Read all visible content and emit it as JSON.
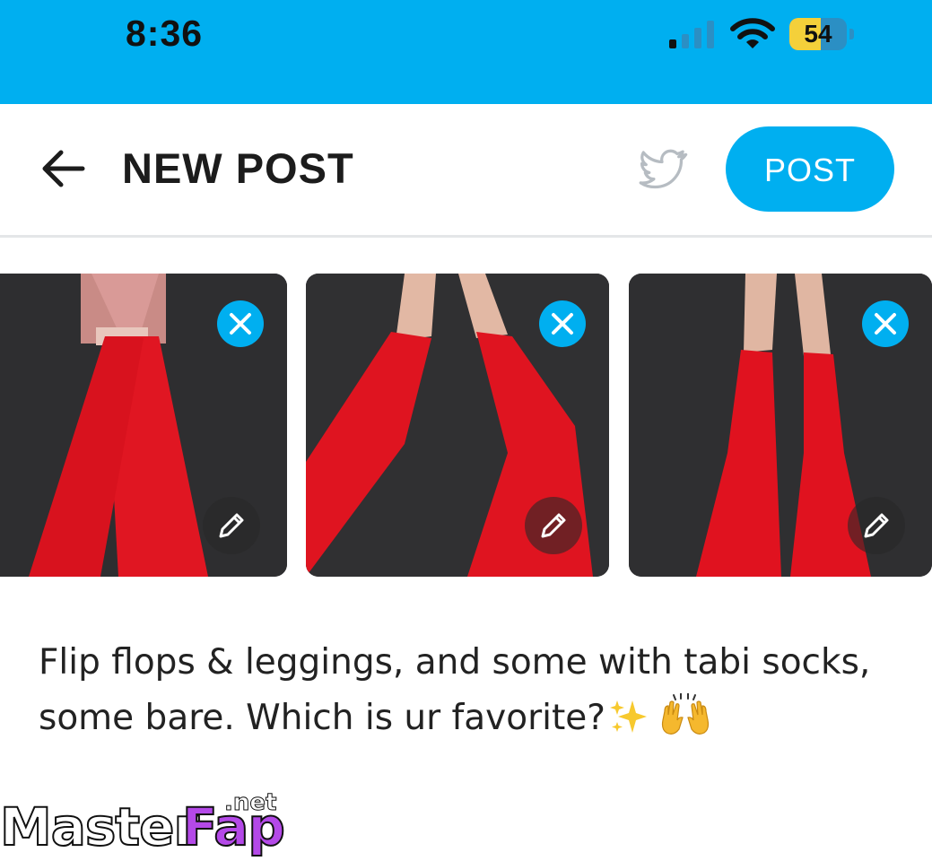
{
  "status_bar": {
    "time": "8:36",
    "battery_percent": "54",
    "battery_level": 0.54,
    "signal_bars_active": 1,
    "signal_bars_total": 4,
    "icons": [
      "signal-icon",
      "wifi-icon",
      "battery-icon"
    ]
  },
  "header": {
    "back_icon": "arrow-left-icon",
    "title": "NEW POST",
    "twitter_icon": "twitter-bird-icon",
    "post_label": "POST"
  },
  "media": [
    {
      "remove_icon": "close-icon",
      "edit_icon": "pencil-icon"
    },
    {
      "remove_icon": "close-icon",
      "edit_icon": "pencil-icon"
    },
    {
      "remove_icon": "close-icon",
      "edit_icon": "pencil-icon"
    }
  ],
  "caption": {
    "text": "Flip flops & leggings, and some with tabi socks, some bare. Which is ur favorite?",
    "emojis": [
      "sparkles-emoji",
      "raising-hands-emoji"
    ]
  },
  "watermark": {
    "part1": "Master",
    "part2": "Fap",
    "suffix": ".net"
  },
  "colors": {
    "accent": "#00aff0",
    "title_text": "#1c1c1c",
    "divider": "#e4e6e8",
    "twitter_icon": "#b6bcc2"
  }
}
